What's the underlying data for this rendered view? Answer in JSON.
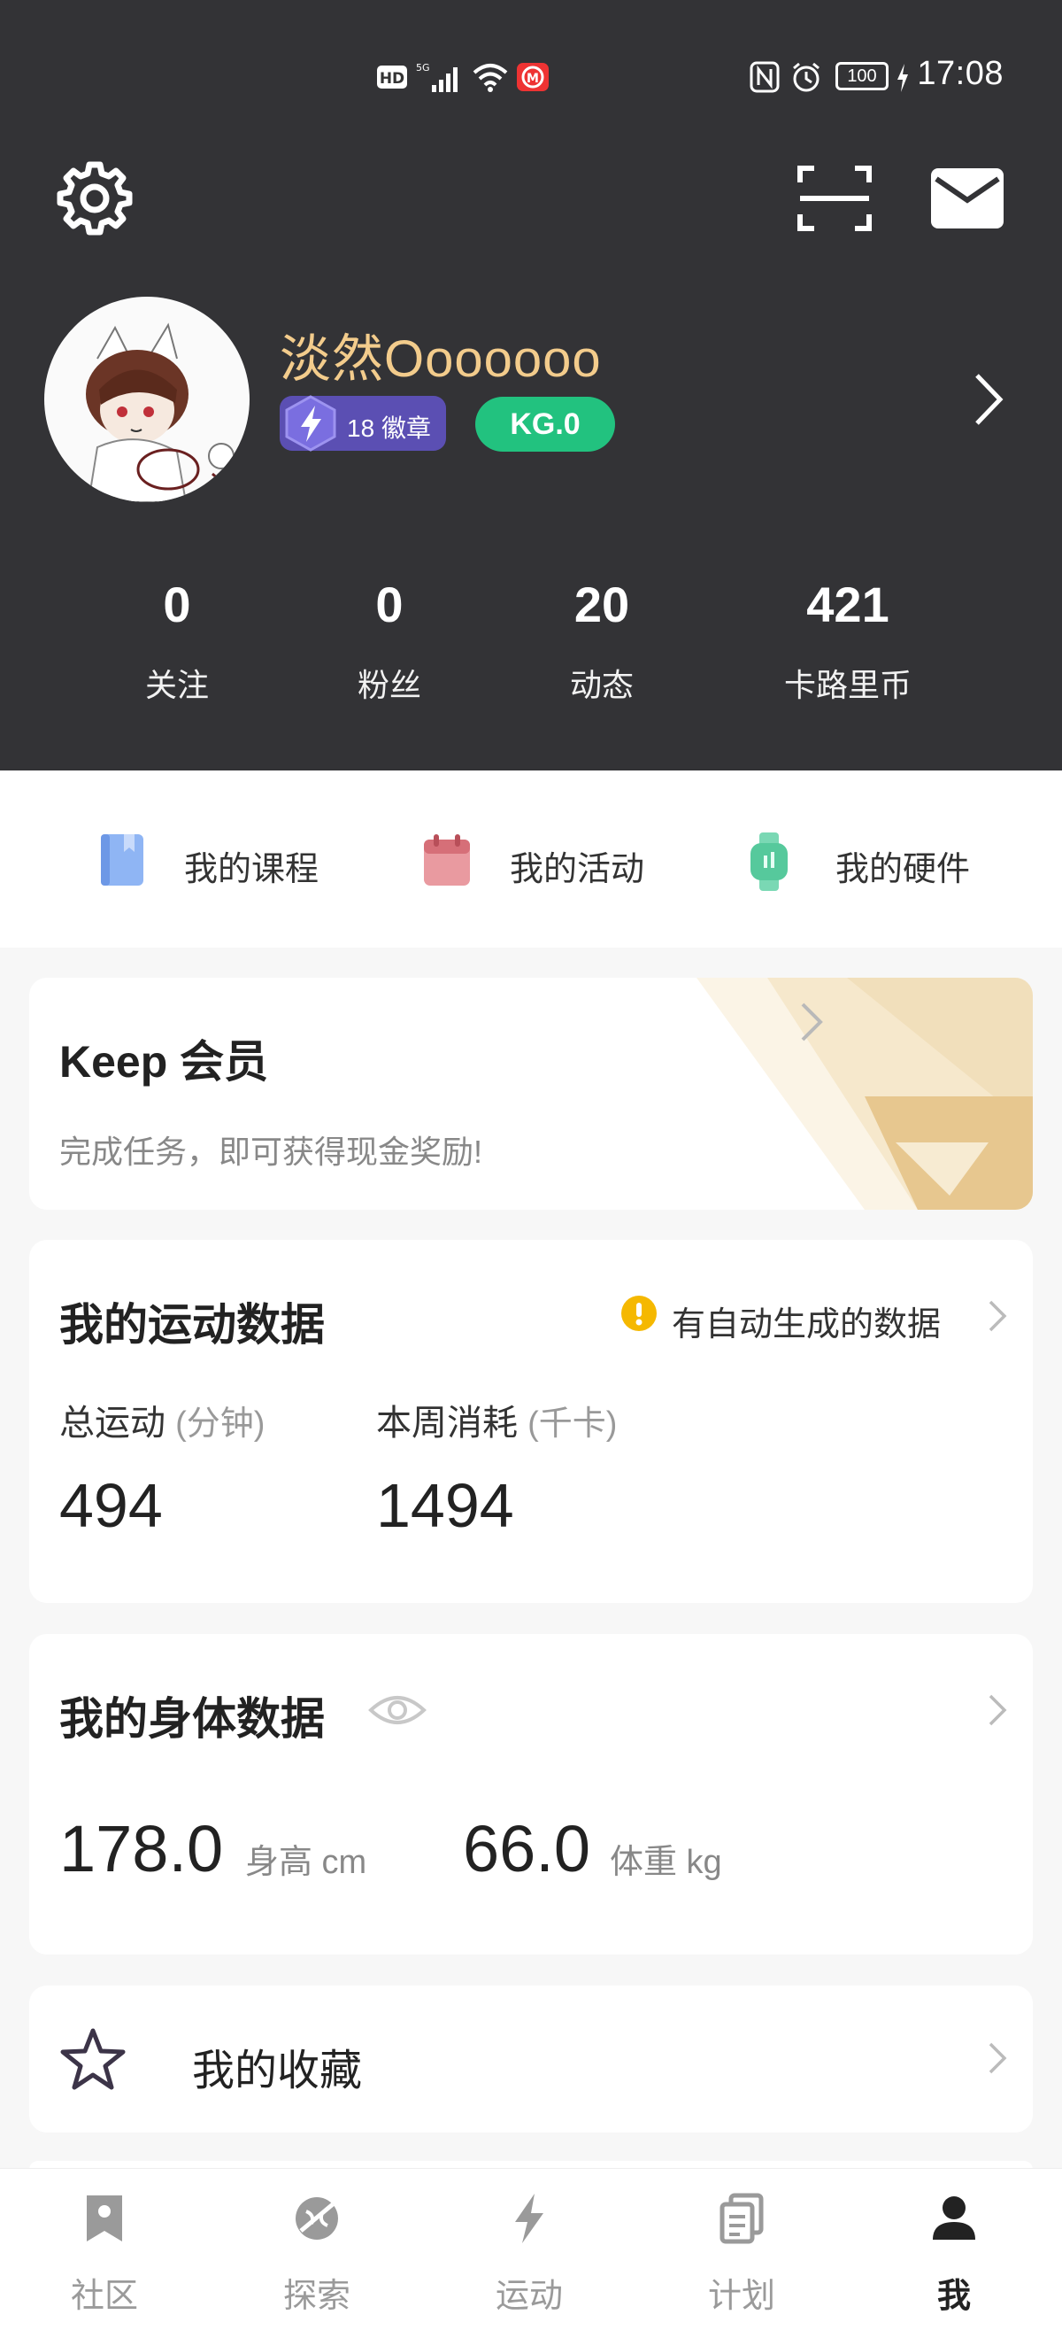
{
  "status_bar": {
    "time": "17:08",
    "battery": "100"
  },
  "profile": {
    "name": "淡然Ooooooo",
    "badges_count": "18",
    "badges_label": "徽章",
    "level": "KG.0"
  },
  "stats": [
    {
      "value": "0",
      "label": "关注"
    },
    {
      "value": "0",
      "label": "粉丝"
    },
    {
      "value": "20",
      "label": "动态"
    },
    {
      "value": "421",
      "label": "卡路里币"
    }
  ],
  "shortcuts": [
    {
      "label": "我的课程",
      "icon": "book-icon"
    },
    {
      "label": "我的活动",
      "icon": "calendar-icon"
    },
    {
      "label": "我的硬件",
      "icon": "watch-icon"
    }
  ],
  "membership": {
    "title": "Keep 会员",
    "subtitle": "完成任务，即可获得现金奖励!"
  },
  "sport_data": {
    "title": "我的运动数据",
    "notice": "有自动生成的数据",
    "total_label": "总运动",
    "total_unit": "(分钟)",
    "total_value": "494",
    "weekly_label": "本周消耗",
    "weekly_unit": "(千卡)",
    "weekly_value": "1494"
  },
  "body_data": {
    "title": "我的身体数据",
    "height_value": "178.0",
    "height_label": "身高 cm",
    "weight_value": "66.0",
    "weight_label": "体重 kg"
  },
  "favorites": {
    "label": "我的收藏"
  },
  "bottom_nav": [
    {
      "label": "社区",
      "icon": "bookmark-icon"
    },
    {
      "label": "探索",
      "icon": "explore-icon"
    },
    {
      "label": "运动",
      "icon": "lightning-icon"
    },
    {
      "label": "计划",
      "icon": "plan-icon"
    },
    {
      "label": "我",
      "icon": "person-icon",
      "active": true
    }
  ],
  "colors": {
    "header_bg": "#333336",
    "name_gold": "#f3cc8c",
    "kg_green": "#22c27f",
    "badge_purple": "#5b4fb3",
    "notice_yellow": "#f5b800"
  }
}
